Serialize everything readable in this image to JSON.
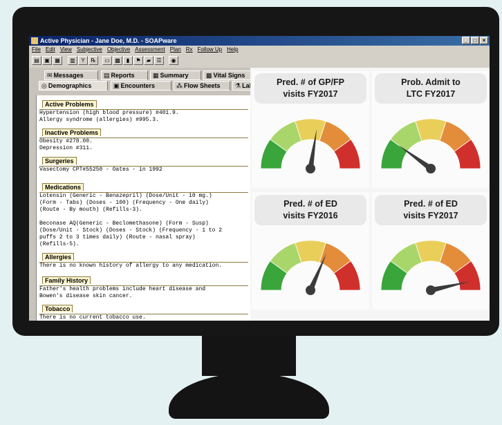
{
  "window": {
    "title": "Active Physician - Jane Doe, M.D. - SOAPware"
  },
  "menu": [
    "File",
    "Edit",
    "View",
    "Subjective",
    "Objective",
    "Assessment",
    "Plan",
    "Rx",
    "Follow Up",
    "Help"
  ],
  "tabs": {
    "row1": [
      "Messages",
      "Reports",
      "Summary",
      "Vital Signs"
    ],
    "row2": [
      "Demographics",
      "Encounters",
      "Flow Sheets",
      "Lab"
    ]
  },
  "sections": [
    {
      "title": "Active Problems",
      "lines": [
        "Hypertension (high blood pressure) #401.9.",
        "Allergy syndrome (allergies) #995.3."
      ]
    },
    {
      "title": "Inactive Problems",
      "lines": [
        "Obesity #278.00.",
        "Depression #311."
      ]
    },
    {
      "title": "Surgeries",
      "lines": [
        "Vasectomy CPT#55250 - Oates - in 1992"
      ]
    },
    {
      "title": "Medications",
      "lines": [
        "Lotensin (Generic - Benazepril) (Dose/Unit - 10 mg.)",
        "(Form - Tabs) (Doses - 100) (Frequency - One daily)",
        "(Route - By mouth) (Refills-3).",
        "",
        "Beconase AQ(Generic - Beclomethasone) (Form - Susp)",
        "(Dose/Unit - Stock) (Doses - Stock) (Frequency - 1 to 2",
        "puffs 2 to 3 times daily) (Route - nasal spray)",
        "(Refills-5)."
      ]
    },
    {
      "title": "Allergies",
      "lines": [
        "There is no known history of allergy to any medication."
      ]
    },
    {
      "title": "Family History",
      "lines": [
        "Father's health problems include heart disease and",
        "Bowen's disease skin cancer."
      ]
    },
    {
      "title": "Tobacco",
      "lines": [
        "There is no current tobacco use."
      ]
    }
  ],
  "gauges": [
    {
      "title_line1": "Pred. # of GP/FP",
      "title_line2": "visits  FY2017",
      "level": 0.55
    },
    {
      "title_line1": "Prob. Admit to",
      "title_line2": "LTC FY2017",
      "level": 0.2
    },
    {
      "title_line1": "Pred.  # of ED",
      "title_line2": "visits FY2016",
      "level": 0.63
    },
    {
      "title_line1": "Pred.  # of ED",
      "title_line2": "visits FY2017",
      "level": 0.93
    }
  ],
  "colors": {
    "gauge_green": "#3aa53a",
    "gauge_lightgreen": "#a9d66a",
    "gauge_yellow": "#e9cf5a",
    "gauge_orange": "#e38d3a",
    "gauge_red": "#d0302c",
    "needle": "#3b3b3b"
  }
}
